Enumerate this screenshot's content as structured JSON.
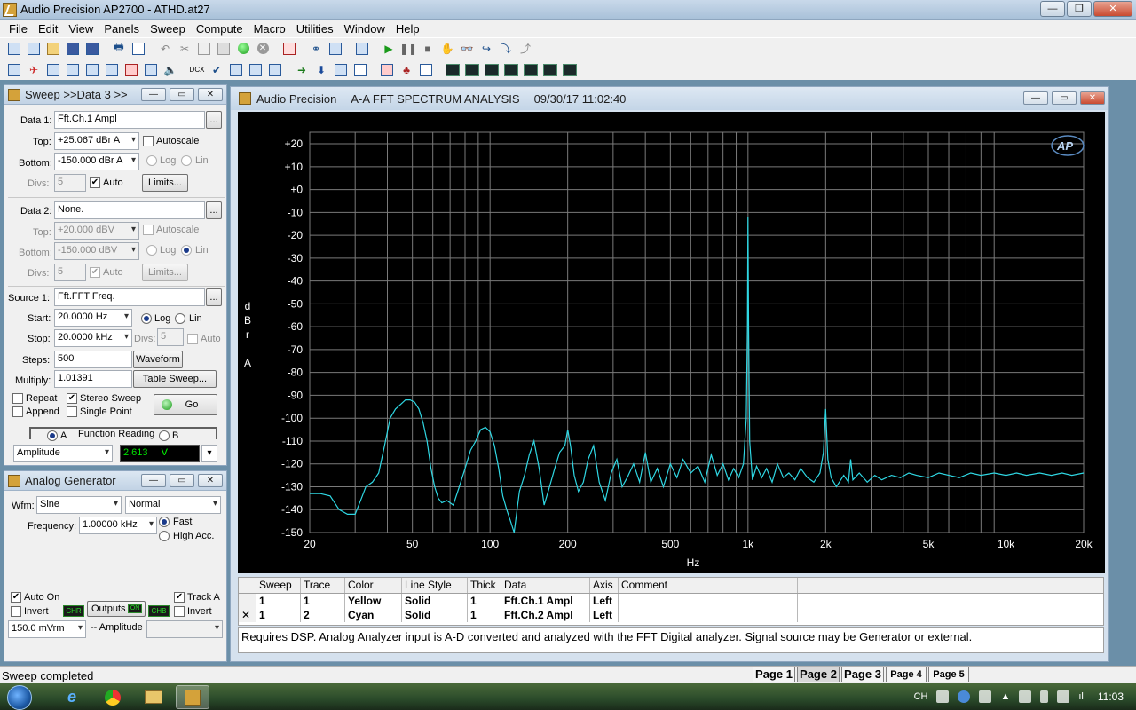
{
  "window": {
    "title": "Audio Precision AP2700 - ATHD.at27"
  },
  "menu": [
    "File",
    "Edit",
    "View",
    "Panels",
    "Sweep",
    "Compute",
    "Macro",
    "Utilities",
    "Window",
    "Help"
  ],
  "sweep_panel": {
    "title": "Sweep >>Data 3 >>",
    "data1": {
      "label": "Data 1:",
      "value": "Fft.Ch.1 Ampl",
      "top_label": "Top:",
      "top": "+25.067  dBr A",
      "autoscale": "Autoscale",
      "bottom_label": "Bottom:",
      "bottom": "-150.000  dBr A",
      "log": "Log",
      "lin": "Lin",
      "divs_label": "Divs:",
      "divs": "5",
      "auto": "Auto",
      "limits": "Limits..."
    },
    "data2": {
      "label": "Data 2:",
      "value": "None.",
      "top_label": "Top:",
      "top": "+20.000  dBV",
      "autoscale": "Autoscale",
      "bottom_label": "Bottom:",
      "bottom": "-150.000  dBV",
      "log": "Log",
      "lin": "Lin",
      "divs_label": "Divs:",
      "divs": "5",
      "auto": "Auto",
      "limits": "Limits..."
    },
    "source1": {
      "label": "Source 1:",
      "value": "Fft.FFT Freq.",
      "start_label": "Start:",
      "start": "20.0000  Hz",
      "log": "Log",
      "lin": "Lin",
      "stop_label": "Stop:",
      "stop": "20.0000  kHz",
      "divs_label": "Divs:",
      "divs": "5",
      "auto": "Auto",
      "steps_label": "Steps:",
      "steps": "500",
      "waveform": "Waveform",
      "multiply_label": "Multiply:",
      "multiply": "1.01391",
      "table_sweep": "Table Sweep..."
    },
    "options": {
      "repeat": "Repeat",
      "stereo_sweep": "Stereo Sweep",
      "append": "Append",
      "single_point": "Single Point",
      "go": "Go"
    }
  },
  "function_reading": {
    "a": "A",
    "label": "Function Reading",
    "b": "B",
    "mode": "Amplitude",
    "value": "2.613",
    "unit": "V"
  },
  "generator": {
    "title": "Analog Generator",
    "wfm_label": "Wfm:",
    "wfm": "Sine",
    "mode": "Normal",
    "freq_label": "Frequency:",
    "freq": "1.00000 kHz",
    "fast": "Fast",
    "high_acc": "High Acc.",
    "auto_on": "Auto On",
    "track_a": "Track A",
    "invert_left": "Invert",
    "chr_a": "CHR",
    "outputs": "Outputs",
    "outputs_state": "ON",
    "chr_b": "CHB",
    "invert_right": "Invert",
    "amplitude": "150.0  mVrm",
    "amplitude_label": "-- Amplitude"
  },
  "graph": {
    "title_app": "Audio Precision",
    "title_desc": "A-A FFT SPECTRUM ANALYSIS",
    "title_time": "09/30/17 11:02:40",
    "logo": "AP"
  },
  "chart_data": {
    "type": "line",
    "title": "A-A FFT SPECTRUM ANALYSIS",
    "xlabel": "Hz",
    "ylabel": "dBrA",
    "xscale": "log",
    "xlim": [
      20,
      20000
    ],
    "ylim": [
      -150,
      25
    ],
    "x_tick_labels": [
      "20",
      "50",
      "100",
      "200",
      "500",
      "1k",
      "2k",
      "5k",
      "10k",
      "20k"
    ],
    "x_tick_values": [
      20,
      50,
      100,
      200,
      500,
      1000,
      2000,
      5000,
      10000,
      20000
    ],
    "y_tick_labels": [
      "+20",
      "+10",
      "+0",
      "-10",
      "-20",
      "-30",
      "-40",
      "-50",
      "-60",
      "-70",
      "-80",
      "-90",
      "-100",
      "-110",
      "-120",
      "-130",
      "-140",
      "-150"
    ],
    "y_tick_values": [
      20,
      10,
      0,
      -10,
      -20,
      -30,
      -40,
      -50,
      -60,
      -70,
      -80,
      -90,
      -100,
      -110,
      -120,
      -130,
      -140,
      -150
    ],
    "grid": true,
    "colors": {
      "background": "#000000",
      "grid": "#7a7a7a",
      "trace": "#2fd7e3",
      "text": "#ffffff"
    },
    "series": [
      {
        "name": "Fft.Ch.2 Ampl",
        "color": "#2fd7e3",
        "x": [
          20,
          22,
          24,
          26,
          28,
          30,
          32,
          33,
          35,
          37,
          39,
          41,
          43,
          45,
          47,
          49,
          51,
          53,
          55,
          57,
          59,
          61,
          63,
          65,
          68,
          72,
          76,
          80,
          84,
          88,
          92,
          96,
          100,
          104,
          108,
          112,
          116,
          120,
          124,
          130,
          136,
          142,
          148,
          155,
          162,
          170,
          178,
          186,
          195,
          200,
          205,
          212,
          220,
          230,
          240,
          252,
          265,
          280,
          295,
          310,
          325,
          340,
          360,
          380,
          400,
          420,
          445,
          470,
          500,
          530,
          560,
          600,
          640,
          680,
          720,
          760,
          800,
          840,
          880,
          920,
          960,
          985,
          995,
          1000,
          1005,
          1015,
          1040,
          1080,
          1130,
          1180,
          1240,
          1300,
          1370,
          1440,
          1520,
          1600,
          1700,
          1800,
          1900,
          1960,
          2000,
          2040,
          2100,
          2200,
          2350,
          2450,
          2500,
          2550,
          2700,
          2900,
          3100,
          3300,
          3600,
          3900,
          4200,
          4500,
          5000,
          5500,
          6000,
          6600,
          7300,
          8000,
          9000,
          10000,
          11000,
          12000,
          13500,
          15000,
          16500,
          18000,
          20000
        ],
        "y": [
          -133,
          -133,
          -134,
          -140,
          -142,
          -142,
          -134,
          -130,
          -128,
          -124,
          -112,
          -100,
          -96,
          -94,
          -92,
          -92,
          -93,
          -96,
          -102,
          -110,
          -122,
          -130,
          -135,
          -137,
          -136,
          -138,
          -130,
          -122,
          -114,
          -110,
          -105,
          -104,
          -106,
          -112,
          -122,
          -134,
          -140,
          -145,
          -150,
          -132,
          -125,
          -116,
          -110,
          -122,
          -138,
          -130,
          -122,
          -115,
          -112,
          -105,
          -112,
          -125,
          -132,
          -128,
          -118,
          -112,
          -128,
          -136,
          -124,
          -118,
          -130,
          -126,
          -120,
          -128,
          -115,
          -128,
          -122,
          -130,
          -120,
          -126,
          -118,
          -124,
          -121,
          -128,
          -116,
          -125,
          -120,
          -127,
          -122,
          -126,
          -120,
          -100,
          -60,
          -12,
          -60,
          -110,
          -127,
          -121,
          -126,
          -122,
          -128,
          -120,
          -126,
          -124,
          -127,
          -122,
          -126,
          -128,
          -124,
          -115,
          -96,
          -118,
          -126,
          -130,
          -125,
          -128,
          -118,
          -127,
          -124,
          -128,
          -125,
          -127,
          -125,
          -126,
          -124,
          -125,
          -126,
          -124,
          -125,
          -126,
          -124,
          -125,
          -124,
          -125,
          -124,
          -125,
          -124,
          -125,
          -124,
          -125,
          -124
        ]
      }
    ]
  },
  "trace_table": {
    "headers": [
      "Sweep",
      "Trace",
      "Color",
      "Line Style",
      "Thick",
      "Data",
      "Axis",
      "Comment"
    ],
    "rows": [
      {
        "checked": "",
        "sweep": "1",
        "trace": "1",
        "color": "Yellow",
        "style": "Solid",
        "thick": "1",
        "data": "Fft.Ch.1 Ampl",
        "axis": "Left"
      },
      {
        "checked": "✕",
        "sweep": "1",
        "trace": "2",
        "color": "Cyan",
        "style": "Solid",
        "thick": "1",
        "data": "Fft.Ch.2 Ampl",
        "axis": "Left"
      }
    ]
  },
  "comment": "Requires DSP.  Analog Analyzer input is A-D converted and analyzed with the FFT Digital analyzer.  Signal source may be Generator or external.",
  "status": "Sweep completed",
  "pages": [
    "Page 1",
    "Page 2",
    "Page 3",
    "Page 4",
    "Page 5"
  ],
  "tray": {
    "lang": "CH",
    "time": "11:03"
  }
}
